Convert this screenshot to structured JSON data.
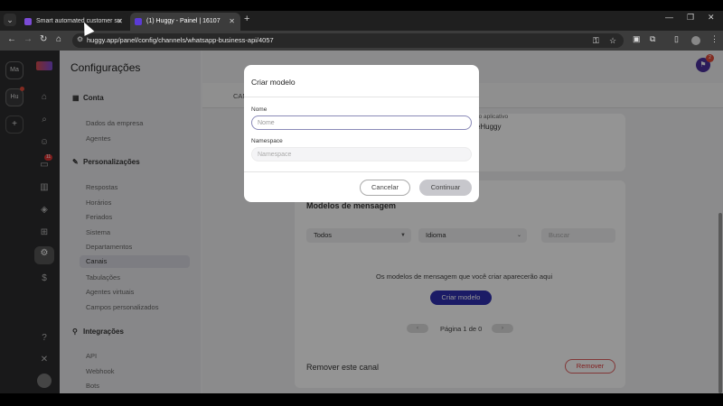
{
  "browser": {
    "tabs": [
      {
        "label": "Smart automated customer su",
        "active": false,
        "favicon_color": "#7b4bd6"
      },
      {
        "label": "(1) Huggy - Painel | 16107",
        "active": true,
        "favicon_color": "#5b3bd6"
      }
    ],
    "url": "huggy.app/panel/config/channels/whatsapp-business-api/4057"
  },
  "workspaces": [
    {
      "label": "Ma"
    },
    {
      "label": "Hu"
    }
  ],
  "nav_icons": [
    {
      "name": "home-icon",
      "glyph": "⌂"
    },
    {
      "name": "search-icon",
      "glyph": "⌕"
    },
    {
      "name": "contacts-icon",
      "glyph": "☺"
    },
    {
      "name": "chat-icon",
      "glyph": "▭",
      "badge": "11"
    },
    {
      "name": "reports-icon",
      "glyph": "▥"
    },
    {
      "name": "shield-icon",
      "glyph": "◈"
    },
    {
      "name": "apps-icon",
      "glyph": "⊞"
    },
    {
      "name": "settings-icon",
      "glyph": "⚙",
      "selected": true
    },
    {
      "name": "billing-icon",
      "glyph": "$"
    },
    {
      "name": "help-icon",
      "glyph": "?"
    },
    {
      "name": "mute-icon",
      "glyph": "✕"
    }
  ],
  "sidebar": {
    "title": "Configurações",
    "sections": [
      {
        "label": "Conta",
        "items": [
          "Dados da empresa",
          "Agentes"
        ]
      },
      {
        "label": "Personalizações",
        "items": [
          "Respostas",
          "Horários",
          "Feriados",
          "Sistema",
          "Departamentos",
          "Canais",
          "Tabulações",
          "Agentes virtuais",
          "Campos personalizados"
        ],
        "selected": "Canais"
      },
      {
        "label": "Integrações",
        "items": [
          "API",
          "Webhook",
          "Bots"
        ]
      }
    ]
  },
  "main": {
    "tab_fragment": "CAN",
    "app_info_label": "do aplicativo",
    "app_info_value": "rteHuggy",
    "templates": {
      "heading": "Modelos de mensagem",
      "filter_all": "Todos",
      "filter_language": "Idioma",
      "search_placeholder": "Buscar",
      "empty_message": "Os modelos de mensagem que você criar aparecerão aqui",
      "create_button": "Criar modelo",
      "pager_text": "Página 1 de 0"
    },
    "remove": {
      "heading": "Remover este canal",
      "button": "Remover"
    }
  },
  "notification_count": "2",
  "modal": {
    "title": "Criar modelo",
    "name_label": "Nome",
    "name_placeholder": "Nome",
    "namespace_label": "Namespace",
    "namespace_placeholder": "Namespace",
    "cancel_label": "Cancelar",
    "continue_label": "Continuar"
  }
}
